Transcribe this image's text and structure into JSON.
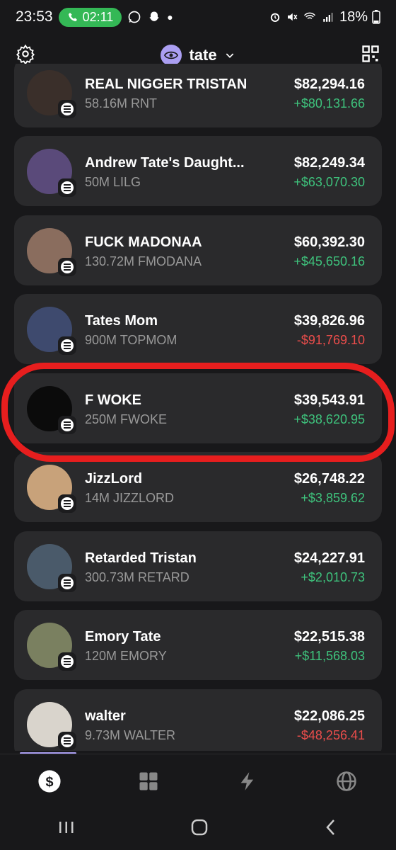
{
  "status_bar": {
    "time": "23:53",
    "call_timer": "02:11",
    "battery": "18%"
  },
  "header": {
    "wallet_name": "tate"
  },
  "tokens": [
    {
      "name": "REAL NIGGER TRISTAN",
      "amount": "58.16M RNT",
      "value": "$82,294.16",
      "change": "+$80,131.66",
      "trend": "positive"
    },
    {
      "name": "Andrew Tate's Daught...",
      "amount": "50M LILG",
      "value": "$82,249.34",
      "change": "+$63,070.30",
      "trend": "positive"
    },
    {
      "name": "FUCK MADONAA",
      "amount": "130.72M FMODANA",
      "value": "$60,392.30",
      "change": "+$45,650.16",
      "trend": "positive"
    },
    {
      "name": "Tates Mom",
      "amount": "900M TOPMOM",
      "value": "$39,826.96",
      "change": "-$91,769.10",
      "trend": "negative"
    },
    {
      "name": "F WOKE",
      "amount": "250M FWOKE",
      "value": "$39,543.91",
      "change": "+$38,620.95",
      "trend": "positive"
    },
    {
      "name": "JizzLord",
      "amount": "14M JIZZLORD",
      "value": "$26,748.22",
      "change": "+$3,859.62",
      "trend": "positive"
    },
    {
      "name": "Retarded Tristan",
      "amount": "300.73M RETARD",
      "value": "$24,227.91",
      "change": "+$2,010.73",
      "trend": "positive"
    },
    {
      "name": "Emory Tate",
      "amount": "120M EMORY",
      "value": "$22,515.38",
      "change": "+$11,568.03",
      "trend": "positive"
    },
    {
      "name": "walter",
      "amount": "9.73M WALTER",
      "value": "$22,086.25",
      "change": "-$48,256.41",
      "trend": "negative"
    }
  ],
  "colors": {
    "background": "#18181a",
    "card": "#2a2a2c",
    "positive": "#3ec27c",
    "negative": "#eb4d4b",
    "accent": "#ab9ff2",
    "highlight_circle": "#e71e1e"
  },
  "tabs": [
    {
      "icon": "dollar-icon",
      "active": true
    },
    {
      "icon": "grid-icon",
      "active": false
    },
    {
      "icon": "lightning-icon",
      "active": false
    },
    {
      "icon": "globe-icon",
      "active": false
    }
  ],
  "avatar_colors": [
    "#3a2f2a",
    "#5a4a7a",
    "#8a6d5e",
    "#3e4a6e",
    "#0b0b0b",
    "#c8a27a",
    "#4a5a6a",
    "#7a8060",
    "#d9d4cc"
  ]
}
